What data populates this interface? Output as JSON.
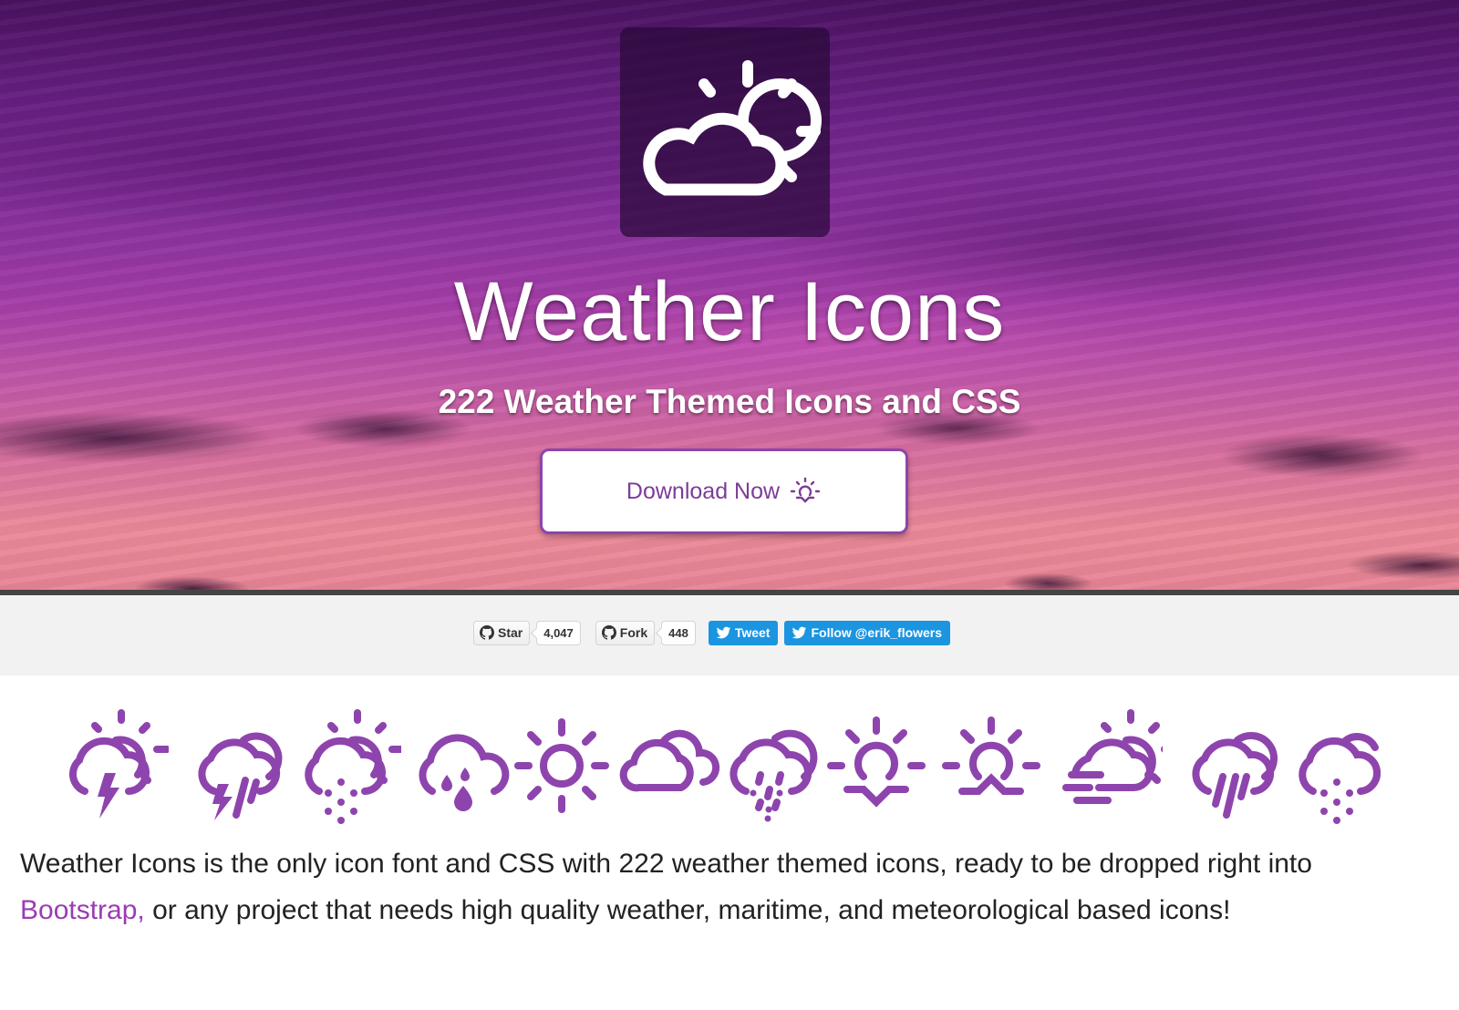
{
  "hero": {
    "logo_icon": "day-cloudy-icon",
    "title": "Weather Icons",
    "subtitle": "222 Weather Themed Icons and CSS",
    "download_button": {
      "label": "Download Now",
      "icon": "sunrise-icon"
    }
  },
  "social": {
    "github_star": {
      "label": "Star",
      "count": "4,047",
      "icon": "github-icon"
    },
    "github_fork": {
      "label": "Fork",
      "count": "448",
      "icon": "github-icon"
    },
    "tweet": {
      "label": "Tweet",
      "icon": "twitter-bird-icon"
    },
    "follow": {
      "label": "Follow @erik_flowers",
      "icon": "twitter-bird-icon"
    }
  },
  "showcase_icons": [
    "day-thunderstorm-icon",
    "day-storm-showers-icon",
    "day-snow-icon",
    "raindrops-icon",
    "day-sunny-icon",
    "cloudy-icon",
    "day-sleet-icon",
    "sunset-icon",
    "sunrise-icon",
    "day-fog-icon",
    "day-rain-icon",
    "night-snow-icon"
  ],
  "intro": {
    "text_before_link": "Weather Icons is the only icon font and CSS with 222 weather themed icons, ready to be dropped right into ",
    "link_label": "Bootstrap,",
    "text_after_link": " or any project that needs high quality weather, maritime, and meteorological based icons!"
  },
  "colors": {
    "accent": "#8e44ad",
    "link": "#9b3cb3",
    "twitter": "#1b95e0",
    "social_bar_bg": "#f2f2f2",
    "text": "#222222"
  }
}
